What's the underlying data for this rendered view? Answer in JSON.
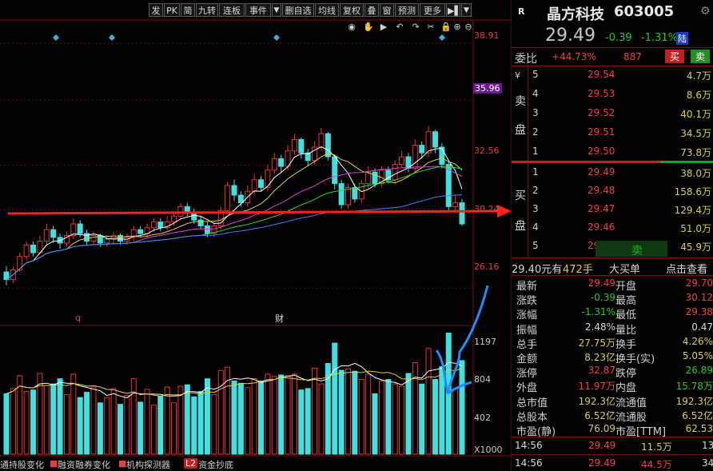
{
  "toolbar": {
    "buttons": [
      "发",
      "PK",
      "简",
      "九转",
      "连板",
      "事件",
      "▼",
      "删自选",
      "均线",
      "复权",
      "叠",
      "窗",
      "预测",
      "更多",
      "▶▌",
      "▼"
    ]
  },
  "chart_tools": {
    "icons": [
      "eye-icon",
      "hand-icon",
      "play-icon",
      "undo-icon",
      "redo-icon",
      "scissors-icon",
      "lock-icon",
      "zoom-in-icon",
      "zoom-out-icon"
    ]
  },
  "chart_data": [
    {
      "type": "candlestick",
      "title": "",
      "price_axis_labels": [
        "38.91",
        "35.96",
        "32.56",
        "30.24",
        "26.16"
      ],
      "highlighted_price": "35.96",
      "y_range": [
        24.5,
        40.0
      ],
      "markers": {
        "q_label": "q",
        "cai_label": "财"
      },
      "candles": [
        [
          27.0,
          26.6,
          27.3,
          26.3
        ],
        [
          26.6,
          27.1,
          27.3,
          26.4
        ],
        [
          27.1,
          27.8,
          28.0,
          27.0
        ],
        [
          27.8,
          28.4,
          28.6,
          27.6
        ],
        [
          28.4,
          28.0,
          28.6,
          27.8
        ],
        [
          28.0,
          28.6,
          28.9,
          27.9
        ],
        [
          28.6,
          29.2,
          29.5,
          28.4
        ],
        [
          29.2,
          28.8,
          29.4,
          28.5
        ],
        [
          28.8,
          28.5,
          29.0,
          28.2
        ],
        [
          28.5,
          28.9,
          29.1,
          28.3
        ],
        [
          28.9,
          29.5,
          29.8,
          28.7
        ],
        [
          29.5,
          29.0,
          29.7,
          28.8
        ],
        [
          29.0,
          28.6,
          29.2,
          28.4
        ],
        [
          28.6,
          28.9,
          29.1,
          28.4
        ],
        [
          28.9,
          28.5,
          29.0,
          28.3
        ],
        [
          28.5,
          28.7,
          28.9,
          28.3
        ],
        [
          28.7,
          28.9,
          29.1,
          28.5
        ],
        [
          28.9,
          28.6,
          29.0,
          28.4
        ],
        [
          28.6,
          28.8,
          29.0,
          28.4
        ],
        [
          28.8,
          29.2,
          29.4,
          28.6
        ],
        [
          29.2,
          29.0,
          29.4,
          28.8
        ],
        [
          29.0,
          29.3,
          29.5,
          28.8
        ],
        [
          29.3,
          29.6,
          29.8,
          29.1
        ],
        [
          29.6,
          29.3,
          29.8,
          29.1
        ],
        [
          29.3,
          29.6,
          29.9,
          29.2
        ],
        [
          29.6,
          29.9,
          30.1,
          29.4
        ],
        [
          29.9,
          30.4,
          30.6,
          29.7
        ],
        [
          30.4,
          30.1,
          30.6,
          29.9
        ],
        [
          30.1,
          29.7,
          30.3,
          29.5
        ],
        [
          29.7,
          29.4,
          29.9,
          29.2
        ],
        [
          29.4,
          29.0,
          29.6,
          28.8
        ],
        [
          29.0,
          29.4,
          29.6,
          28.8
        ],
        [
          29.4,
          30.2,
          30.4,
          29.2
        ],
        [
          30.2,
          31.5,
          31.7,
          30.0
        ],
        [
          31.5,
          31.0,
          31.8,
          30.7
        ],
        [
          31.0,
          30.6,
          31.2,
          30.4
        ],
        [
          30.6,
          31.2,
          31.5,
          30.4
        ],
        [
          31.2,
          31.8,
          32.1,
          31.0
        ],
        [
          31.8,
          31.4,
          32.0,
          31.2
        ],
        [
          31.4,
          32.3,
          32.6,
          31.2
        ],
        [
          32.3,
          32.9,
          33.2,
          32.1
        ],
        [
          32.9,
          32.5,
          33.1,
          32.2
        ],
        [
          32.5,
          33.3,
          33.6,
          32.3
        ],
        [
          33.3,
          33.9,
          34.2,
          33.1
        ],
        [
          33.9,
          33.2,
          34.0,
          32.9
        ],
        [
          33.2,
          32.8,
          33.4,
          32.5
        ],
        [
          32.8,
          33.5,
          33.8,
          32.6
        ],
        [
          33.5,
          34.2,
          34.5,
          33.3
        ],
        [
          34.2,
          33.0,
          34.3,
          32.8
        ],
        [
          33.0,
          31.6,
          33.1,
          31.3
        ],
        [
          31.6,
          30.5,
          31.8,
          30.3
        ],
        [
          30.5,
          31.4,
          31.6,
          30.3
        ],
        [
          31.4,
          30.8,
          31.6,
          30.6
        ],
        [
          30.8,
          31.6,
          31.8,
          30.6
        ],
        [
          31.6,
          32.2,
          32.5,
          31.4
        ],
        [
          32.2,
          31.6,
          32.4,
          31.4
        ],
        [
          31.6,
          32.3,
          32.5,
          31.4
        ],
        [
          32.3,
          31.8,
          32.5,
          31.6
        ],
        [
          31.8,
          32.6,
          32.8,
          31.6
        ],
        [
          32.6,
          33.0,
          33.3,
          32.4
        ],
        [
          33.0,
          32.4,
          33.2,
          32.2
        ],
        [
          32.4,
          33.6,
          33.9,
          32.2
        ],
        [
          33.6,
          33.2,
          33.8,
          32.9
        ],
        [
          33.2,
          34.3,
          34.6,
          33.0
        ],
        [
          34.3,
          33.5,
          34.4,
          33.2
        ],
        [
          33.5,
          32.6,
          33.7,
          32.4
        ],
        [
          32.6,
          30.4,
          32.8,
          30.2
        ],
        [
          30.4,
          30.6,
          31.0,
          30.1
        ],
        [
          30.6,
          29.5,
          30.8,
          29.4
        ]
      ]
    },
    {
      "type": "bar",
      "title": "",
      "volume_axis_labels": [
        "1197",
        "804",
        "402",
        "X1000"
      ],
      "y_range": [
        0,
        1400
      ]
    }
  ],
  "indicator_tabs": [
    "通持股变化",
    "融资融券变化",
    "机构探测器",
    "L2",
    "资金抄底"
  ],
  "stock": {
    "logo": "R",
    "name": "晶方科技",
    "code": "603005",
    "price": "29.49",
    "change": "-0.39",
    "change_pct": "-1.31%",
    "exchange": "陆",
    "wei_bi_label": "委比",
    "wei_bi": "+44.73%",
    "wei_cha": "887",
    "buy_btn": "买",
    "sell_btn": "卖"
  },
  "asks": [
    {
      "level": "5",
      "price": "29.54",
      "vol": "4.7万"
    },
    {
      "level": "4",
      "price": "29.53",
      "vol": "8.6万"
    },
    {
      "level": "3",
      "price": "29.52",
      "vol": "40.1万"
    },
    {
      "level": "2",
      "price": "29.51",
      "vol": "34.5万"
    },
    {
      "level": "1",
      "price": "29.50",
      "vol": "73.8万"
    }
  ],
  "bids": [
    {
      "level": "1",
      "price": "29.49",
      "vol": "38.0万"
    },
    {
      "level": "2",
      "price": "29.48",
      "vol": "158.6万"
    },
    {
      "level": "3",
      "price": "29.47",
      "vol": "129.4万"
    },
    {
      "level": "4",
      "price": "29.46",
      "vol": "51.0万"
    },
    {
      "level": "5",
      "price": "29.45",
      "vol": "45.9万"
    }
  ],
  "ask_side_label": [
    "¥",
    "卖",
    "盘"
  ],
  "bid_side_label": [
    "买",
    "盘"
  ],
  "bid5_tag": "卖",
  "big_order": {
    "price": "29.40元有",
    "hands": "472手",
    "label": "大买单",
    "link": "点击查看"
  },
  "stats": [
    {
      "l1": "最新",
      "v1": "29.49",
      "c1": "red",
      "l2": "开盘",
      "v2": "29.70",
      "c2": "red"
    },
    {
      "l1": "涨跌",
      "v1": "-0.39",
      "c1": "green",
      "l2": "最高",
      "v2": "30.12",
      "c2": "red"
    },
    {
      "l1": "涨幅",
      "v1": "-1.31%",
      "c1": "green",
      "l2": "最低",
      "v2": "29.38",
      "c2": "red"
    },
    {
      "l1": "振幅",
      "v1": "2.48%",
      "c1": "white",
      "l2": "量比",
      "v2": "0.47",
      "c2": "white"
    },
    {
      "l1": "总手",
      "v1": "27.75万",
      "c1": "yellow",
      "l2": "换手",
      "v2": "4.26%",
      "c2": "yellow"
    },
    {
      "l1": "金额",
      "v1": "8.23亿",
      "c1": "yellow",
      "l2": "换手(实)",
      "v2": "5.05%",
      "c2": "yellow"
    },
    {
      "l1": "涨停",
      "v1": "32.87",
      "c1": "red",
      "l2": "跌停",
      "v2": "26.89",
      "c2": "green"
    },
    {
      "l1": "外盘",
      "v1": "11.97万",
      "c1": "red",
      "l2": "内盘",
      "v2": "15.78万",
      "c2": "green"
    },
    {
      "l1": "总市值",
      "v1": "192.3亿",
      "c1": "yellow",
      "l2": "流通值",
      "v2": "192.3亿",
      "c2": "yellow"
    },
    {
      "l1": "总股本",
      "v1": "6.52亿",
      "c1": "yellow",
      "l2": "流通股",
      "v2": "6.52亿",
      "c2": "yellow"
    },
    {
      "l1": "市盈(静)",
      "v1": "76.09",
      "c1": "yellow",
      "l2": "市盈[TTM]",
      "v2": "62.53",
      "c2": "yellow"
    }
  ],
  "ticks": [
    {
      "time": "14:56",
      "price": "29.49",
      "vol": "11.5万",
      "extra": "13"
    },
    {
      "time": "14:56",
      "price": "29.49",
      "vol": "44.5万",
      "extra": "34"
    }
  ]
}
